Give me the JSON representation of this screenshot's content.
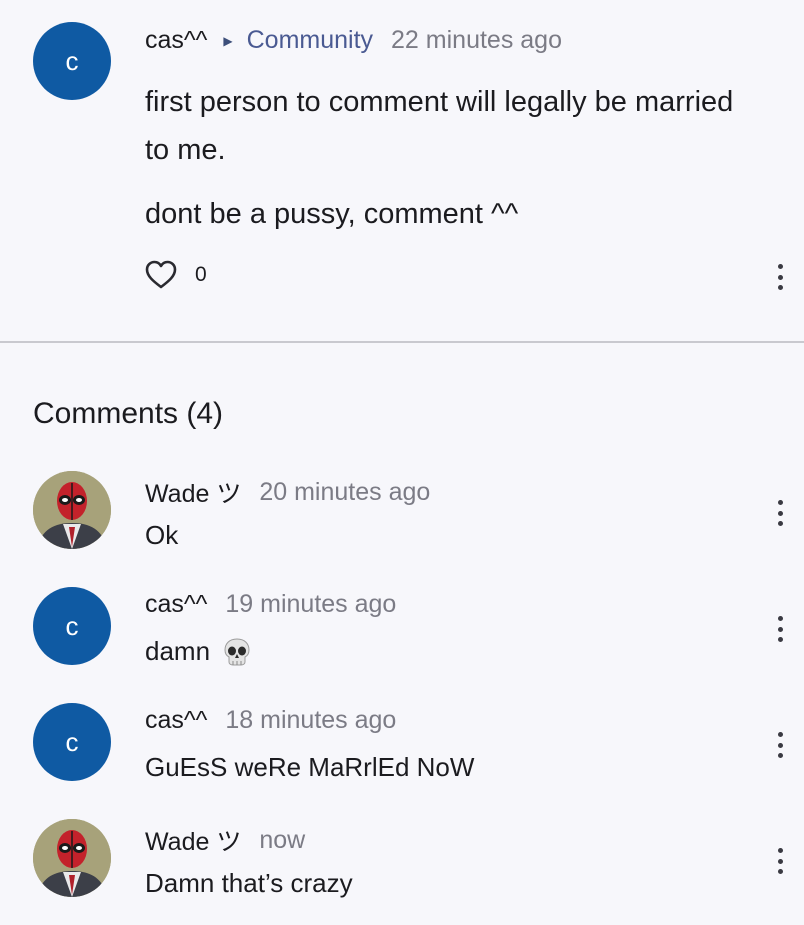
{
  "post": {
    "author": "cas^^",
    "avatar_letter": "c",
    "community": "Community",
    "time": "22 minutes ago",
    "paragraphs": [
      "first person to comment will legally be married to me.",
      "dont be a pussy, comment ^^"
    ],
    "likes": "0"
  },
  "comments_heading": "Comments (4)",
  "comments": [
    {
      "author": "Wade ツ",
      "time": "20 minutes ago",
      "text": "Ok",
      "avatar": "deadpool-avatar"
    },
    {
      "author": "cas^^",
      "time": "19 minutes ago",
      "text": "damn",
      "avatar_letter": "c",
      "emoji": "skull-emoji"
    },
    {
      "author": "cas^^",
      "time": "18 minutes ago",
      "text": "GuEsS weRe MaRrlEd NoW",
      "avatar_letter": "c"
    },
    {
      "author": "Wade ツ",
      "time": "now",
      "text": "Damn that’s crazy",
      "avatar": "deadpool-avatar"
    }
  ],
  "colors": {
    "background": "#f7f7fb",
    "avatar": "#0f5aa3",
    "community_link": "#4a5a92",
    "muted": "#7b7b85"
  }
}
